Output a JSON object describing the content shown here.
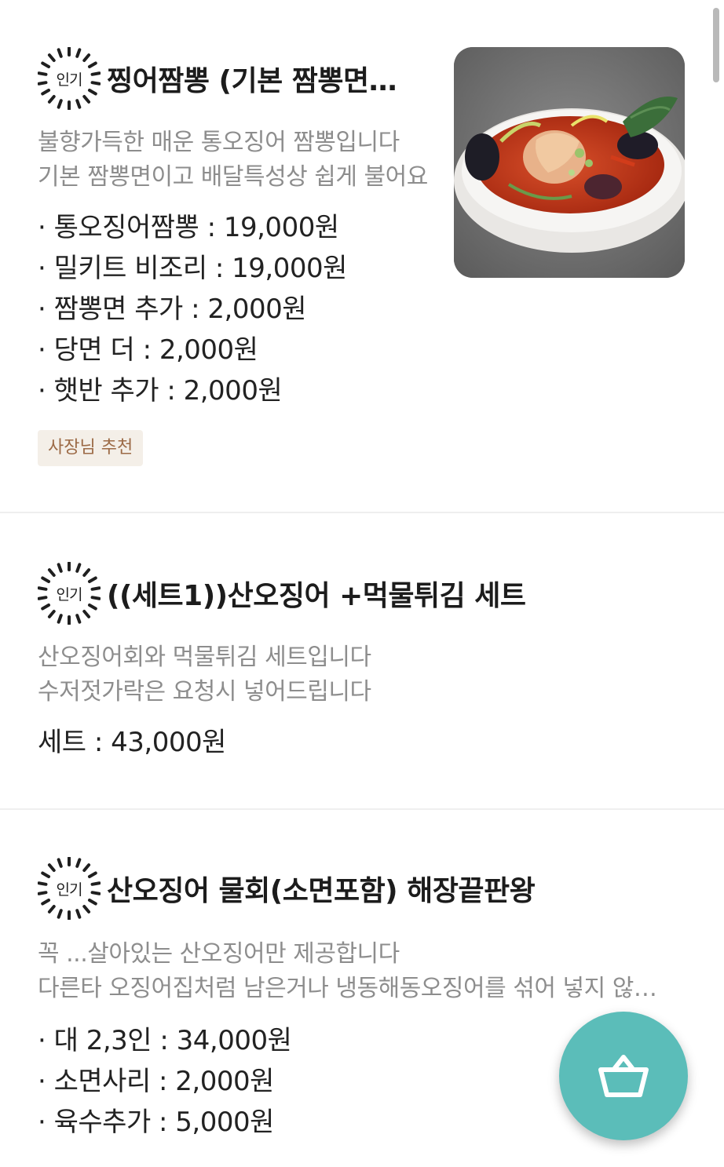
{
  "menu": [
    {
      "badge": "인기",
      "title": "찡어짬뽕 (기본  짬뽕면이고  배달특성상)",
      "description": [
        "불향가득한  매운 통오징어 짬뽕입니다",
        "기본 짬뽕면이고  배달특성상  쉽게 불어요"
      ],
      "prices": [
        "· 통오징어짬뽕 : 19,000원",
        "· 밀키트 비조리 : 19,000원",
        "· 짬뽕면 추가 : 2,000원",
        "· 당면 더 : 2,000원",
        "· 햇반  추가 : 2,000원"
      ],
      "tag": "사장님 추천"
    },
    {
      "badge": "인기",
      "title": "((세트1))산오징어 +먹물튀김 세트",
      "description": [
        "산오징어회와  먹물튀김 세트입니다",
        "수저젓가락은 요청시 넣어드립니다"
      ],
      "prices": [
        "세트 : 43,000원"
      ]
    },
    {
      "badge": "인기",
      "title": "산오징어  물회(소면포함)  해장끝판왕",
      "description": [
        "꼭  ...살아있는  산오징어만  제공합니다",
        "다른타 오징어집처럼  남은거나 냉동해동오징어를  섞어 넣지 않습니다"
      ],
      "prices": [
        "· 대 2,3인 : 34,000원",
        "· 소면사리 : 2,000원",
        "· 육수추가 : 5,000원"
      ]
    }
  ],
  "colors": {
    "accent": "#5bbdb9",
    "tag_bg": "#f4efe8",
    "tag_text": "#9c6a46",
    "description": "#8d8d8d"
  },
  "icons": {
    "badge": "popular-burst-badge",
    "cart": "shopping-basket-icon"
  }
}
